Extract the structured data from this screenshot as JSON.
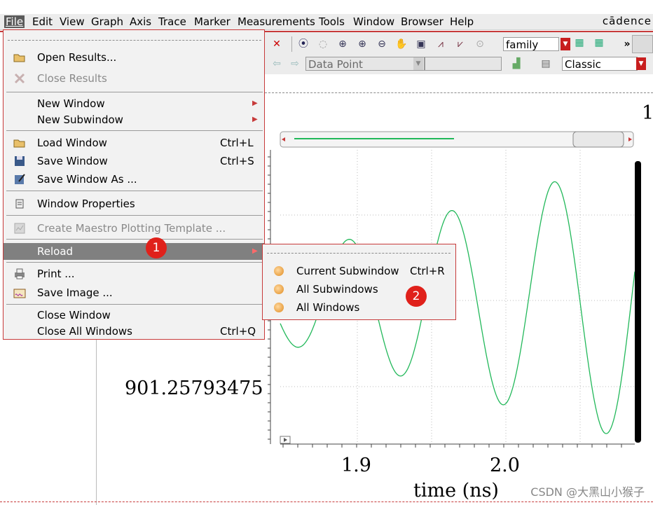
{
  "menubar": {
    "items": [
      "File",
      "Edit",
      "View",
      "Graph",
      "Axis",
      "Trace",
      "Marker",
      "Measurements",
      "Tools",
      "Window",
      "Browser",
      "Help"
    ],
    "brand": "cādence"
  },
  "toolbar": {
    "family_value": "family",
    "data_point_value": "Data Point",
    "classic_value": "Classic",
    "more_label": "»"
  },
  "plot": {
    "top_right_label": "1",
    "y_tick_label": "901.25793475",
    "x_tick_labels": [
      "1.9",
      "2.0"
    ],
    "x_axis_label": "time (ns)",
    "trace_color": "#22b85a"
  },
  "file_menu": {
    "items": [
      {
        "label": "Open Results...",
        "shortcut": "",
        "icon": "folder-open-icon",
        "enabled": true,
        "submenu": false
      },
      {
        "label": "Close Results",
        "shortcut": "",
        "icon": "close-x-icon",
        "enabled": false,
        "submenu": false
      },
      {
        "label": "New Window",
        "shortcut": "",
        "icon": "",
        "enabled": true,
        "submenu": true
      },
      {
        "label": "New Subwindow",
        "shortcut": "",
        "icon": "",
        "enabled": true,
        "submenu": true
      },
      {
        "label": "Load Window",
        "shortcut": "Ctrl+L",
        "icon": "folder-open-icon",
        "enabled": true,
        "submenu": false
      },
      {
        "label": "Save Window",
        "shortcut": "Ctrl+S",
        "icon": "floppy-disk-icon",
        "enabled": true,
        "submenu": false
      },
      {
        "label": "Save Window As ...",
        "shortcut": "",
        "icon": "save-as-icon",
        "enabled": true,
        "submenu": false
      },
      {
        "label": "Window Properties",
        "shortcut": "",
        "icon": "properties-icon",
        "enabled": true,
        "submenu": false
      },
      {
        "label": "Create Maestro Plotting Template ...",
        "shortcut": "",
        "icon": "template-icon",
        "enabled": false,
        "submenu": false
      },
      {
        "label": "Reload",
        "shortcut": "",
        "icon": "",
        "enabled": true,
        "submenu": true
      },
      {
        "label": "Print ...",
        "shortcut": "",
        "icon": "printer-icon",
        "enabled": true,
        "submenu": false
      },
      {
        "label": "Save Image ...",
        "shortcut": "",
        "icon": "image-icon",
        "enabled": true,
        "submenu": false
      },
      {
        "label": "Close Window",
        "shortcut": "",
        "icon": "",
        "enabled": true,
        "submenu": false
      },
      {
        "label": "Close All Windows",
        "shortcut": "Ctrl+Q",
        "icon": "",
        "enabled": true,
        "submenu": false
      }
    ]
  },
  "reload_submenu": {
    "items": [
      {
        "label": "Current Subwindow",
        "shortcut": "Ctrl+R"
      },
      {
        "label": "All Subwindows",
        "shortcut": ""
      },
      {
        "label": "All Windows",
        "shortcut": ""
      }
    ]
  },
  "badges": [
    "1",
    "2"
  ],
  "watermark": "CSDN @大黑山小猴子"
}
